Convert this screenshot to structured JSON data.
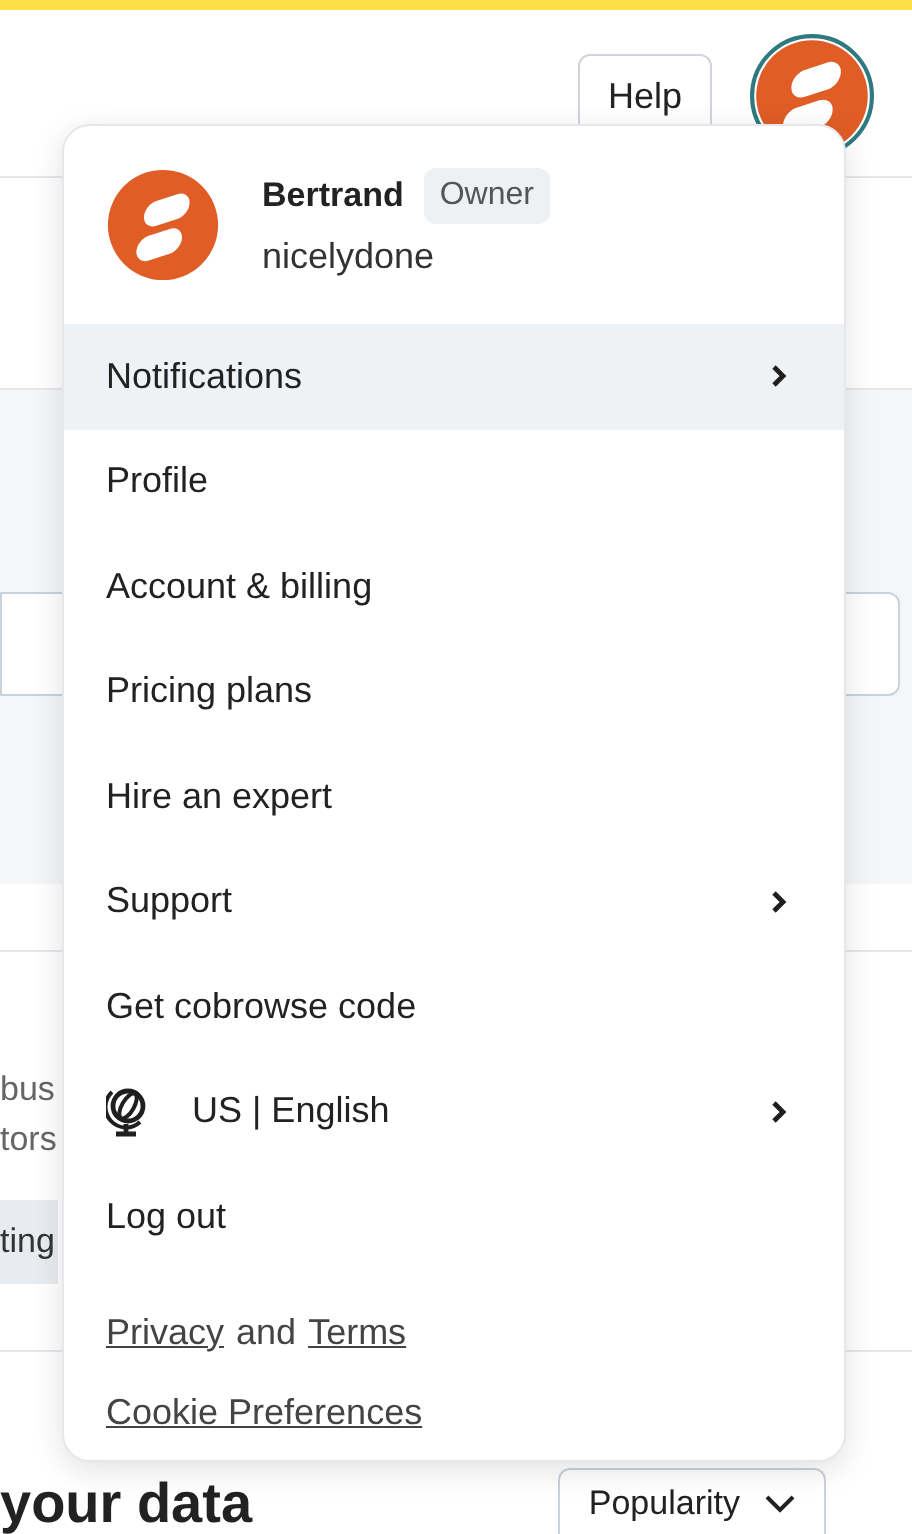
{
  "header": {
    "help_button": "Help"
  },
  "background": {
    "text_lines": [
      "bus",
      "tors"
    ],
    "tag": "ting",
    "heading": "your data",
    "sort_dropdown": "Popularity"
  },
  "account_menu": {
    "name": "Bertrand",
    "role": "Owner",
    "workspace": "nicelydone",
    "items": [
      {
        "label": "Notifications",
        "kind": "plain",
        "submenu": true,
        "highlighted": true
      },
      {
        "label": "Profile",
        "kind": "plain",
        "submenu": false,
        "highlighted": false
      },
      {
        "label": "Account & billing",
        "kind": "plain",
        "submenu": false,
        "highlighted": false
      },
      {
        "label": "Pricing plans",
        "kind": "plain",
        "submenu": false,
        "highlighted": false
      },
      {
        "label": "Hire an expert",
        "kind": "plain",
        "submenu": false,
        "highlighted": false
      },
      {
        "label": "Support",
        "kind": "plain",
        "submenu": true,
        "highlighted": false
      },
      {
        "label": "Get cobrowse code",
        "kind": "plain",
        "submenu": false,
        "highlighted": false
      },
      {
        "label": "US | English",
        "kind": "language",
        "submenu": true,
        "highlighted": false
      },
      {
        "label": "Log out",
        "kind": "plain",
        "submenu": false,
        "highlighted": false
      }
    ],
    "footer": {
      "privacy": "Privacy",
      "conjunction": "and",
      "terms": "Terms",
      "cookies": "Cookie Preferences"
    }
  }
}
